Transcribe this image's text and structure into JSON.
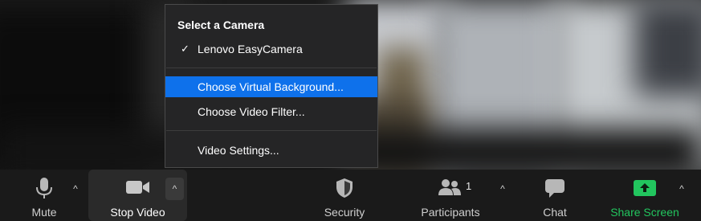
{
  "camera_menu": {
    "heading": "Select a Camera",
    "items": [
      {
        "label": "Lenovo EasyCamera",
        "checked": true,
        "selected": false
      },
      {
        "label": "Choose Virtual Background...",
        "checked": false,
        "selected": true
      },
      {
        "label": "Choose Video Filter...",
        "checked": false,
        "selected": false
      },
      {
        "label": "Video Settings...",
        "checked": false,
        "selected": false
      }
    ],
    "check_glyph": "✓"
  },
  "toolbar": {
    "mute_label": "Mute",
    "stop_video_label": "Stop Video",
    "security_label": "Security",
    "participants_label": "Participants",
    "participants_count": "1",
    "chat_label": "Chat",
    "share_screen_label": "Share Screen",
    "caret_glyph": "^"
  },
  "icons": {
    "mute": "microphone-icon",
    "video": "video-camera-icon",
    "security": "shield-icon",
    "participants": "people-icon",
    "chat": "chat-bubble-icon",
    "share": "share-screen-icon"
  },
  "colors": {
    "menu_background": "#252526",
    "menu_highlight": "#0e71eb",
    "toolbar_background": "#1a1a1a",
    "share_green": "#22c55e",
    "text_light": "#cfcfcf"
  }
}
